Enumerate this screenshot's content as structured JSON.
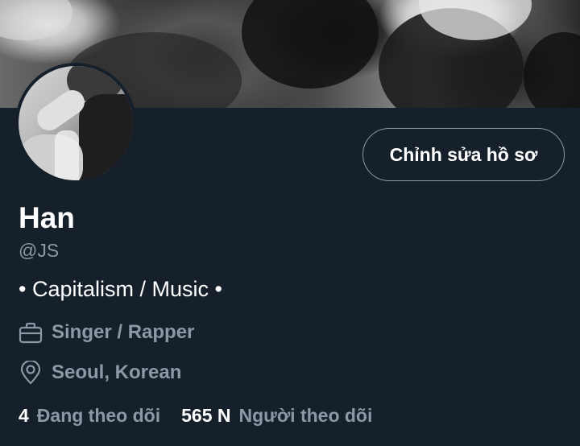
{
  "profile": {
    "display_name": "Han",
    "handle": "@JS",
    "bio": "• Capitalism / Music •",
    "job": "Singer / Rapper",
    "location": "Seoul, Korean",
    "edit_button_label": "Chỉnh sửa hồ sơ"
  },
  "stats": {
    "following_count": "4",
    "following_label": "Đang theo dõi",
    "followers_count": "565 N",
    "followers_label": "Người theo dõi"
  },
  "icons": {
    "job": "briefcase-icon",
    "location": "location-pin-icon"
  },
  "colors": {
    "background": "#15202b",
    "secondary_text": "#8b98a5",
    "primary_text": "#ffffff"
  }
}
